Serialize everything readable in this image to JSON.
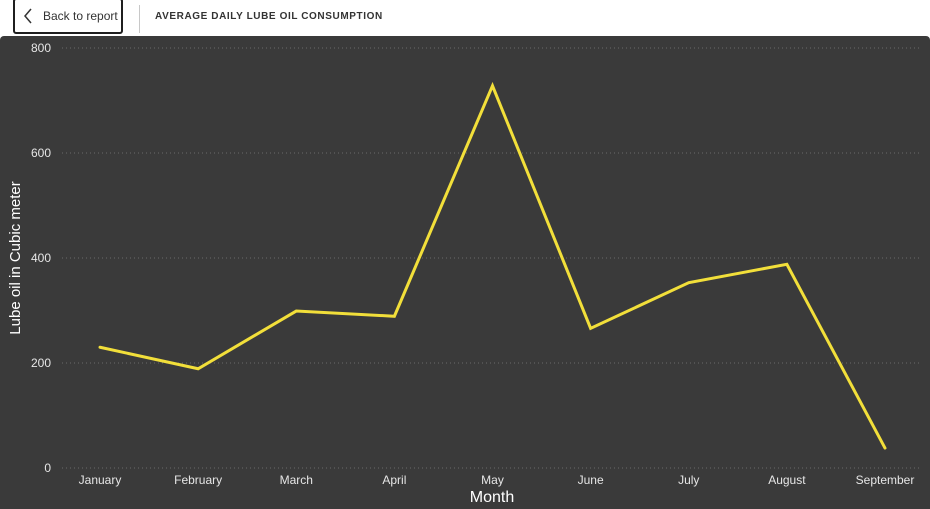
{
  "header": {
    "back_label": "Back to report",
    "title": "AVERAGE DAILY LUBE OIL CONSUMPTION"
  },
  "colors": {
    "background": "#3a3a3a",
    "line": "#f2df3a",
    "grid": "#6a6a6a",
    "text": "#e6e6e6"
  },
  "chart_data": {
    "type": "line",
    "categories": [
      "January",
      "February",
      "March",
      "April",
      "May",
      "June",
      "July",
      "August",
      "September"
    ],
    "series": [
      {
        "values": [
          230,
          189,
          299,
          289,
          728,
          266,
          353,
          388,
          38
        ]
      }
    ],
    "xlabel": "Month",
    "ylabel": "Lube oil in Cubic meter",
    "ylim": [
      0,
      800
    ],
    "yticks": [
      0,
      200,
      400,
      600,
      800
    ],
    "grid": true,
    "grid_style": "dotted"
  }
}
